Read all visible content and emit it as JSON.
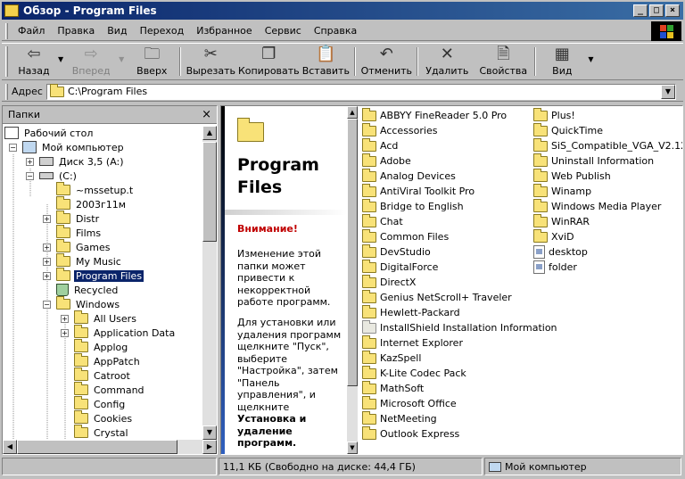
{
  "window": {
    "title": "Обзор - Program Files",
    "controls": {
      "minimize": "_",
      "maximize": "□",
      "close": "×"
    }
  },
  "menu": [
    "Файл",
    "Правка",
    "Вид",
    "Переход",
    "Избранное",
    "Сервис",
    "Справка"
  ],
  "toolbar": {
    "back": "Назад",
    "forward": "Вперед",
    "up": "Вверх",
    "cut": "Вырезать",
    "copy": "Копировать",
    "paste": "Вставить",
    "undo": "Отменить",
    "delete": "Удалить",
    "properties": "Свойства",
    "view": "Вид"
  },
  "address": {
    "label": "Адрес",
    "value": "C:\\Program Files"
  },
  "folders_pane": {
    "title": "Папки",
    "close": "×",
    "tree": [
      {
        "label": "Рабочий стол",
        "icon": "desktop-icon"
      },
      {
        "label": "Мой компьютер",
        "icon": "computer-icon",
        "toggle": "−"
      },
      {
        "label": "Диск 3,5 (A:)",
        "icon": "floppy-icon",
        "toggle": "+"
      },
      {
        "label": "(C:)",
        "icon": "drive-icon",
        "toggle": "−"
      },
      {
        "label": "~mssetup.t",
        "icon": "folder-icon"
      },
      {
        "label": "2003г11м",
        "icon": "folder-icon"
      },
      {
        "label": "Distr",
        "icon": "folder-icon",
        "toggle": "+"
      },
      {
        "label": "Films",
        "icon": "folder-icon"
      },
      {
        "label": "Games",
        "icon": "folder-icon",
        "toggle": "+"
      },
      {
        "label": "My Music",
        "icon": "folder-icon",
        "toggle": "+"
      },
      {
        "label": "Program Files",
        "icon": "folder-icon",
        "toggle": "+",
        "selected": true
      },
      {
        "label": "Recycled",
        "icon": "recycle-bin-icon"
      },
      {
        "label": "Windows",
        "icon": "folder-icon",
        "toggle": "−"
      },
      {
        "label": "All Users",
        "icon": "folder-icon",
        "toggle": "+"
      },
      {
        "label": "Application Data",
        "icon": "folder-icon",
        "toggle": "+"
      },
      {
        "label": "Applog",
        "icon": "folder-icon"
      },
      {
        "label": "AppPatch",
        "icon": "folder-icon"
      },
      {
        "label": "Catroot",
        "icon": "folder-icon"
      },
      {
        "label": "Command",
        "icon": "folder-icon"
      },
      {
        "label": "Config",
        "icon": "folder-icon"
      },
      {
        "label": "Cookies",
        "icon": "folder-icon"
      },
      {
        "label": "Crystal",
        "icon": "folder-icon"
      }
    ]
  },
  "info_panel": {
    "title_line1": "Program",
    "title_line2": "Files",
    "warning": "Внимание!",
    "text1": "Изменение этой папки может привести к некорректной работе программ.",
    "text2_part1": "Для установки или удаления программ щелкните \"Пуск\", выберите \"Настройка\", затем \"Панель управления\", и щелкните ",
    "text2_bold": "Установка и удаление программ."
  },
  "files": {
    "column1": [
      "ABBYY FineReader 5.0 Pro",
      "Accessories",
      "Acd",
      "Adobe",
      "Analog Devices",
      "AntiViral Toolkit Pro",
      "Bridge to English",
      "Chat",
      "Common Files",
      "DevStudio",
      "DigitalForce",
      "DirectX",
      "Genius NetScroll+ Traveler",
      "Hewlett-Packard",
      "InstallShield Installation Information",
      "Internet Explorer",
      "KazSpell",
      "K-Lite Codec Pack",
      "MathSoft",
      "Microsoft Office",
      "NetMeeting",
      "Outlook Express"
    ],
    "column2": [
      "Plus!",
      "QuickTime",
      "SiS_Compatible_VGA_V2.12",
      "Uninstall Information",
      "Web Publish",
      "Winamp",
      "Windows Media Player",
      "WinRAR",
      "XviD",
      "desktop",
      "folder"
    ]
  },
  "status": {
    "size": "11,1 КБ (Свободно на диске: 44,4 ГБ)",
    "location": "Мой компьютер"
  }
}
